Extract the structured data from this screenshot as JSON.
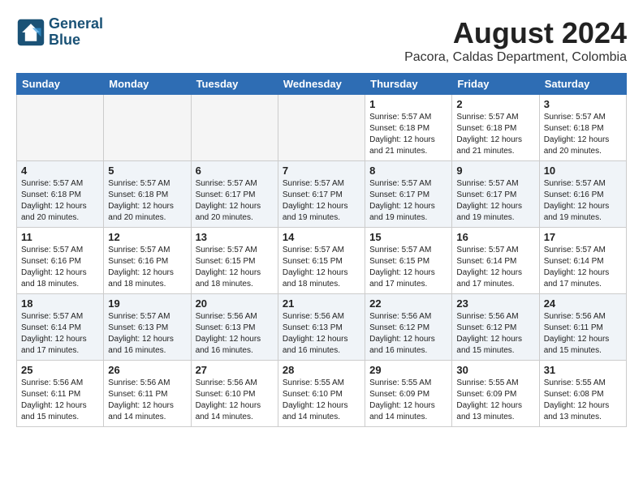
{
  "header": {
    "logo_line1": "General",
    "logo_line2": "Blue",
    "month_year": "August 2024",
    "location": "Pacora, Caldas Department, Colombia"
  },
  "weekdays": [
    "Sunday",
    "Monday",
    "Tuesday",
    "Wednesday",
    "Thursday",
    "Friday",
    "Saturday"
  ],
  "weeks": [
    [
      {
        "day": "",
        "info": ""
      },
      {
        "day": "",
        "info": ""
      },
      {
        "day": "",
        "info": ""
      },
      {
        "day": "",
        "info": ""
      },
      {
        "day": "1",
        "info": "Sunrise: 5:57 AM\nSunset: 6:18 PM\nDaylight: 12 hours\nand 21 minutes."
      },
      {
        "day": "2",
        "info": "Sunrise: 5:57 AM\nSunset: 6:18 PM\nDaylight: 12 hours\nand 21 minutes."
      },
      {
        "day": "3",
        "info": "Sunrise: 5:57 AM\nSunset: 6:18 PM\nDaylight: 12 hours\nand 20 minutes."
      }
    ],
    [
      {
        "day": "4",
        "info": "Sunrise: 5:57 AM\nSunset: 6:18 PM\nDaylight: 12 hours\nand 20 minutes."
      },
      {
        "day": "5",
        "info": "Sunrise: 5:57 AM\nSunset: 6:18 PM\nDaylight: 12 hours\nand 20 minutes."
      },
      {
        "day": "6",
        "info": "Sunrise: 5:57 AM\nSunset: 6:17 PM\nDaylight: 12 hours\nand 20 minutes."
      },
      {
        "day": "7",
        "info": "Sunrise: 5:57 AM\nSunset: 6:17 PM\nDaylight: 12 hours\nand 19 minutes."
      },
      {
        "day": "8",
        "info": "Sunrise: 5:57 AM\nSunset: 6:17 PM\nDaylight: 12 hours\nand 19 minutes."
      },
      {
        "day": "9",
        "info": "Sunrise: 5:57 AM\nSunset: 6:17 PM\nDaylight: 12 hours\nand 19 minutes."
      },
      {
        "day": "10",
        "info": "Sunrise: 5:57 AM\nSunset: 6:16 PM\nDaylight: 12 hours\nand 19 minutes."
      }
    ],
    [
      {
        "day": "11",
        "info": "Sunrise: 5:57 AM\nSunset: 6:16 PM\nDaylight: 12 hours\nand 18 minutes."
      },
      {
        "day": "12",
        "info": "Sunrise: 5:57 AM\nSunset: 6:16 PM\nDaylight: 12 hours\nand 18 minutes."
      },
      {
        "day": "13",
        "info": "Sunrise: 5:57 AM\nSunset: 6:15 PM\nDaylight: 12 hours\nand 18 minutes."
      },
      {
        "day": "14",
        "info": "Sunrise: 5:57 AM\nSunset: 6:15 PM\nDaylight: 12 hours\nand 18 minutes."
      },
      {
        "day": "15",
        "info": "Sunrise: 5:57 AM\nSunset: 6:15 PM\nDaylight: 12 hours\nand 17 minutes."
      },
      {
        "day": "16",
        "info": "Sunrise: 5:57 AM\nSunset: 6:14 PM\nDaylight: 12 hours\nand 17 minutes."
      },
      {
        "day": "17",
        "info": "Sunrise: 5:57 AM\nSunset: 6:14 PM\nDaylight: 12 hours\nand 17 minutes."
      }
    ],
    [
      {
        "day": "18",
        "info": "Sunrise: 5:57 AM\nSunset: 6:14 PM\nDaylight: 12 hours\nand 17 minutes."
      },
      {
        "day": "19",
        "info": "Sunrise: 5:57 AM\nSunset: 6:13 PM\nDaylight: 12 hours\nand 16 minutes."
      },
      {
        "day": "20",
        "info": "Sunrise: 5:56 AM\nSunset: 6:13 PM\nDaylight: 12 hours\nand 16 minutes."
      },
      {
        "day": "21",
        "info": "Sunrise: 5:56 AM\nSunset: 6:13 PM\nDaylight: 12 hours\nand 16 minutes."
      },
      {
        "day": "22",
        "info": "Sunrise: 5:56 AM\nSunset: 6:12 PM\nDaylight: 12 hours\nand 16 minutes."
      },
      {
        "day": "23",
        "info": "Sunrise: 5:56 AM\nSunset: 6:12 PM\nDaylight: 12 hours\nand 15 minutes."
      },
      {
        "day": "24",
        "info": "Sunrise: 5:56 AM\nSunset: 6:11 PM\nDaylight: 12 hours\nand 15 minutes."
      }
    ],
    [
      {
        "day": "25",
        "info": "Sunrise: 5:56 AM\nSunset: 6:11 PM\nDaylight: 12 hours\nand 15 minutes."
      },
      {
        "day": "26",
        "info": "Sunrise: 5:56 AM\nSunset: 6:11 PM\nDaylight: 12 hours\nand 14 minutes."
      },
      {
        "day": "27",
        "info": "Sunrise: 5:56 AM\nSunset: 6:10 PM\nDaylight: 12 hours\nand 14 minutes."
      },
      {
        "day": "28",
        "info": "Sunrise: 5:55 AM\nSunset: 6:10 PM\nDaylight: 12 hours\nand 14 minutes."
      },
      {
        "day": "29",
        "info": "Sunrise: 5:55 AM\nSunset: 6:09 PM\nDaylight: 12 hours\nand 14 minutes."
      },
      {
        "day": "30",
        "info": "Sunrise: 5:55 AM\nSunset: 6:09 PM\nDaylight: 12 hours\nand 13 minutes."
      },
      {
        "day": "31",
        "info": "Sunrise: 5:55 AM\nSunset: 6:08 PM\nDaylight: 12 hours\nand 13 minutes."
      }
    ]
  ]
}
